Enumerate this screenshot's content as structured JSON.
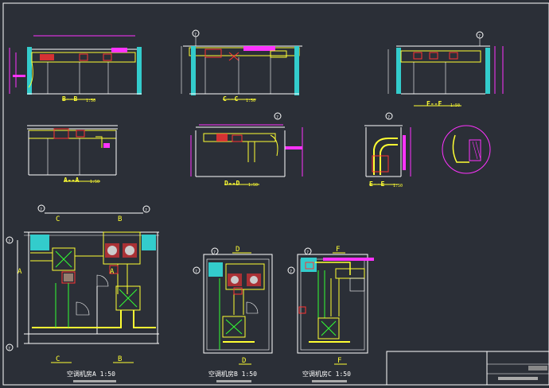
{
  "drawing": {
    "sections": {
      "bb": "B--B",
      "cc": "C--C",
      "ff": "F--F",
      "aa": "A--A",
      "dd": "D--D",
      "ee": "E--E"
    },
    "scale_small": "1:50",
    "plans": {
      "a_title": "空调机房A 1:50",
      "b_title": "空调机房B 1:50",
      "c_title": "空调机房C 1:50"
    },
    "plan_marks": {
      "c": "C",
      "b": "B",
      "a": "A",
      "d": "D",
      "f": "F"
    },
    "grid_bubble": "?",
    "colors": {
      "background": "#2b2f37",
      "wall": "#ffffff",
      "duct": "#ffff33",
      "dimension": "#ff33ff",
      "equipment": "#33cccc",
      "pipe": "#33ff33",
      "fan": "#ff3333"
    }
  }
}
